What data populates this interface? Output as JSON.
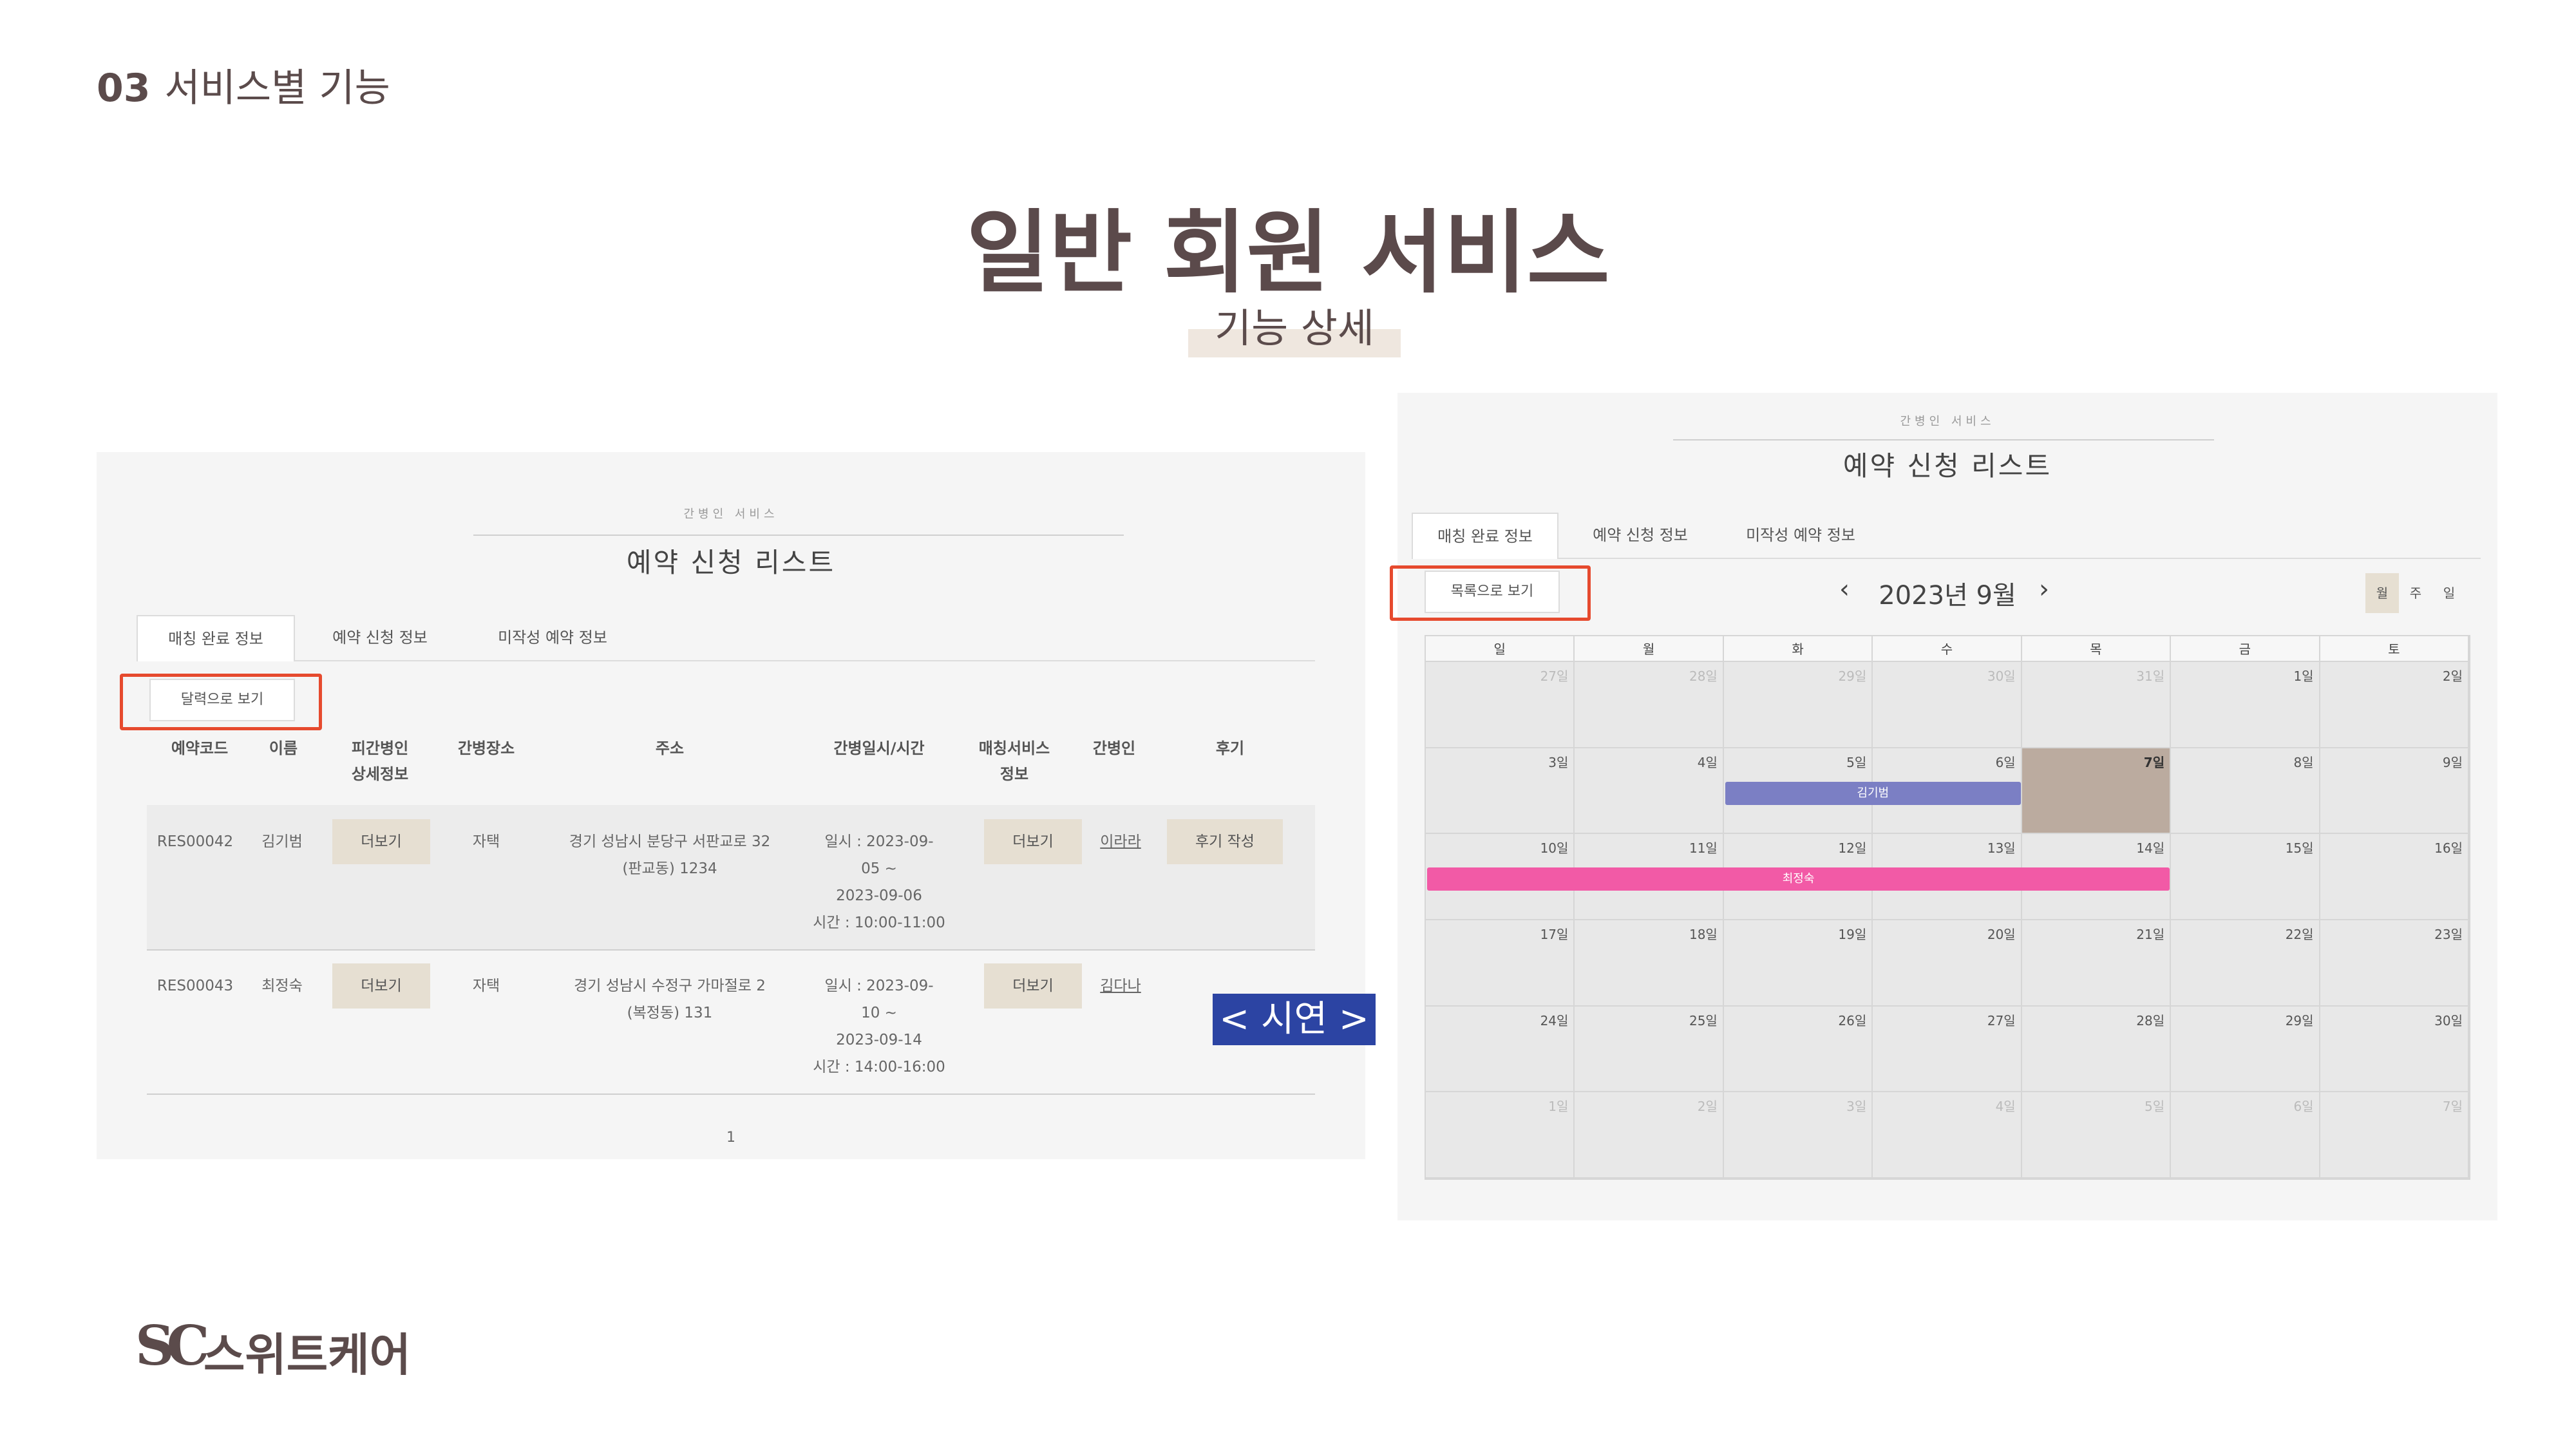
{
  "slide": {
    "section_number": "03",
    "section_title": "서비스별 기능",
    "title": "일반 회원 서비스",
    "subtitle": "기능 상세",
    "demo_label": "< 시연 >",
    "brand_logo": "SC",
    "brand_name": "스위트케어"
  },
  "list_panel": {
    "kicker": "간병인 서비스",
    "title": "예약 신청 리스트",
    "tabs": [
      {
        "label": "매칭 완료 정보",
        "active": true
      },
      {
        "label": "예약 신청 정보",
        "active": false
      },
      {
        "label": "미작성 예약 정보",
        "active": false
      }
    ],
    "calendar_view_button": "달력으로 보기",
    "columns": [
      "예약코드",
      "이름",
      "피간병인\n상세정보",
      "간병장소",
      "주소",
      "간병일시/시간",
      "매칭서비스\n정보",
      "간병인",
      "후기"
    ],
    "col_h1": "예약코드",
    "col_h2": "이름",
    "col_h3a": "피간병인",
    "col_h3b": "상세정보",
    "col_h4": "간병장소",
    "col_h5": "주소",
    "col_h6": "간병일시/시간",
    "col_h7a": "매칭서비스",
    "col_h7b": "정보",
    "col_h8": "간병인",
    "col_h9": "후기",
    "rows": [
      {
        "code": "RES00042",
        "name": "김기범",
        "detail_button": "더보기",
        "place": "자택",
        "address_line1": "경기 성남시 분당구 서판교로 32",
        "address_line2": "(판교동) 1234",
        "date_line1": "일시 : 2023-09-",
        "date_line2": "05 ~",
        "date_line3": "2023-09-06",
        "date_line4": "시간 : 10:00-11:00",
        "service_button": "더보기",
        "caregiver": "이라라",
        "review_button": "후기 작성"
      },
      {
        "code": "RES00043",
        "name": "최정숙",
        "detail_button": "더보기",
        "place": "자택",
        "address_line1": "경기 성남시 수정구 가마절로 2",
        "address_line2": "(복정동) 131",
        "date_line1": "일시 : 2023-09-",
        "date_line2": "10 ~",
        "date_line3": "2023-09-14",
        "date_line4": "시간 : 14:00-16:00",
        "service_button": "더보기",
        "caregiver": "김다나",
        "review_button": ""
      }
    ],
    "page": "1"
  },
  "calendar_panel": {
    "kicker": "간병인 서비스",
    "title": "예약 신청 리스트",
    "tabs": [
      {
        "label": "매칭 완료 정보",
        "active": true
      },
      {
        "label": "예약 신청 정보",
        "active": false
      },
      {
        "label": "미작성 예약 정보",
        "active": false
      }
    ],
    "list_view_button": "목록으로 보기",
    "prev_icon": "‹",
    "next_icon": "›",
    "month_label": "2023년 9월",
    "views": [
      {
        "label": "월",
        "active": true
      },
      {
        "label": "주",
        "active": false
      },
      {
        "label": "일",
        "active": false
      }
    ],
    "weekdays": [
      "일",
      "월",
      "화",
      "수",
      "목",
      "금",
      "토"
    ],
    "weeks": [
      [
        "27일",
        "28일",
        "29일",
        "30일",
        "31일",
        "1일",
        "2일"
      ],
      [
        "3일",
        "4일",
        "5일",
        "6일",
        "7일",
        "8일",
        "9일"
      ],
      [
        "10일",
        "11일",
        "12일",
        "13일",
        "14일",
        "15일",
        "16일"
      ],
      [
        "17일",
        "18일",
        "19일",
        "20일",
        "21일",
        "22일",
        "23일"
      ],
      [
        "24일",
        "25일",
        "26일",
        "27일",
        "28일",
        "29일",
        "30일"
      ],
      [
        "1일",
        "2일",
        "3일",
        "4일",
        "5일",
        "6일",
        "7일"
      ]
    ],
    "today": "7일",
    "events": [
      {
        "label": "김기범",
        "start": "5일",
        "end": "6일",
        "color": "#7b7fc4"
      },
      {
        "label": "최정숙",
        "start": "10일",
        "end": "14일",
        "color": "#f25aa6"
      }
    ]
  },
  "colors": {
    "title_text": "#5b4a4b",
    "highlight_box": "#e64a2e",
    "demo_badge": "#2c44a3",
    "beige_button": "#e6dfd2",
    "today_cell": "#bbab9f"
  }
}
